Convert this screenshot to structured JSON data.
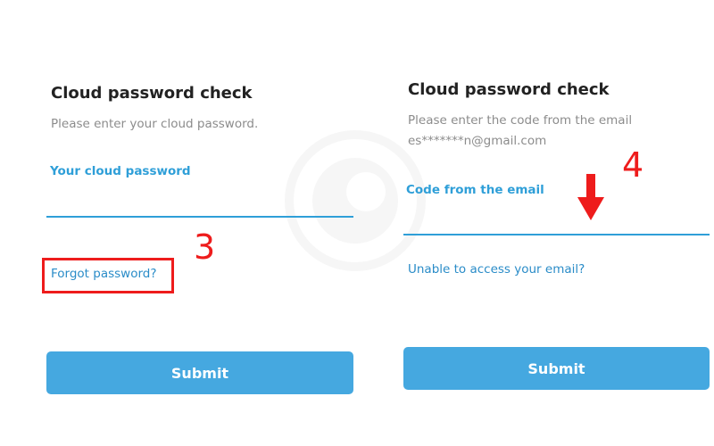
{
  "left_panel": {
    "title": "Cloud password check",
    "description": "Please enter your cloud password.",
    "field_label": "Your cloud password",
    "field_value": "",
    "link": "Forgot password?",
    "submit": "Submit",
    "annotation": "3"
  },
  "right_panel": {
    "title": "Cloud password check",
    "description_line1": "Please enter the code from the email",
    "description_line2": "es*******n@gmail.com",
    "field_label": "Code from the email",
    "field_value": "",
    "link": "Unable to access your email?",
    "submit": "Submit",
    "annotation": "4"
  },
  "colors": {
    "accent": "#2f9fd8",
    "button": "#45a8e0",
    "annotation": "#ee1c1c"
  },
  "icons": [
    "watermark-logo-icon",
    "down-arrow-icon"
  ]
}
